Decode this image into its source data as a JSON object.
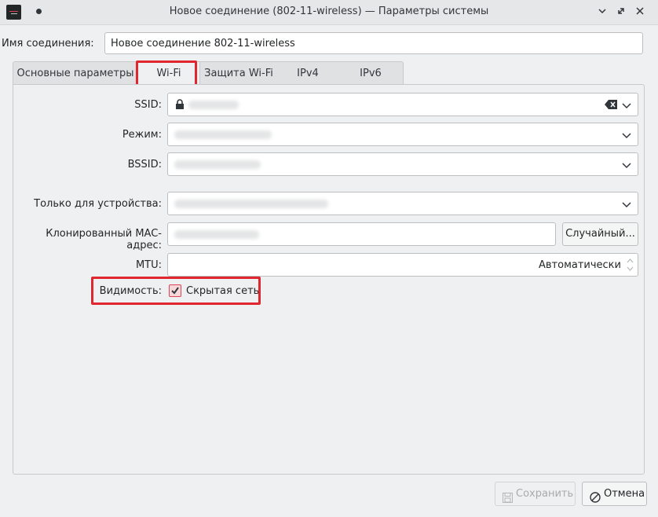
{
  "window": {
    "title": "Новое соединение (802-11-wireless) — Параметры системы"
  },
  "connection": {
    "label": "Имя соединения:",
    "value": "Новое соединение 802-11-wireless"
  },
  "tabs": [
    {
      "label": "Основные параметры"
    },
    {
      "label": "Wi-Fi"
    },
    {
      "label": "Защита Wi-Fi"
    },
    {
      "label": "IPv4"
    },
    {
      "label": "IPv6"
    }
  ],
  "active_tab": "Wi-Fi",
  "form": {
    "ssid_label": "SSID:",
    "mode_label": "Режим:",
    "bssid_label": "BSSID:",
    "device_label": "Только для устройства:",
    "mac_label": "Клонированный MAC-адрес:",
    "random_button": "Случайный...",
    "mtu_label": "MTU:",
    "mtu_value": "Автоматически",
    "visibility_label": "Видимость:",
    "hidden_network_label": "Скрытая сеть"
  },
  "hidden_network_checked": true,
  "buttons": {
    "save": "Сохранить",
    "cancel": "Отмена"
  },
  "colors": {
    "highlight": "#e0262f",
    "accent": "#da4453"
  }
}
